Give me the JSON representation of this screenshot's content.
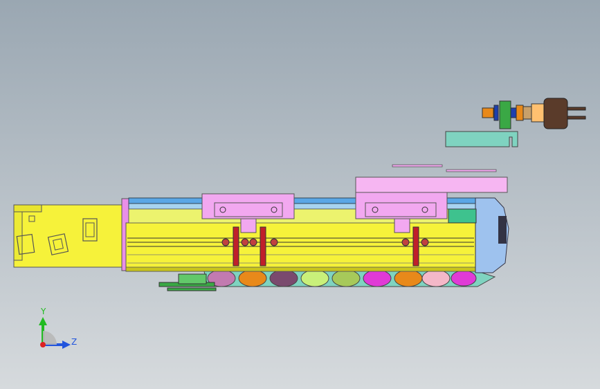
{
  "colors": {
    "bg_top": "#9aa7b2",
    "bg_bottom": "#d6dadd",
    "yellow": "#f6f23a",
    "yellow_dark": "#c9c51d",
    "pink": "#f2a8f0",
    "blue": "#5aa7e6",
    "teal": "#7fd3c0",
    "red": "#c0202a",
    "brown": "#5a3b2a",
    "green": "#3aa845",
    "magenta": "#e03ad6",
    "orange": "#e8891a",
    "lightgreen": "#c9f07a",
    "purple": "#7a4a6e",
    "axis_y": "#22bb22",
    "axis_z": "#2255dd",
    "axis_origin": "#dd2222"
  },
  "triad": {
    "y_label": "Y",
    "z_label": "Z"
  }
}
